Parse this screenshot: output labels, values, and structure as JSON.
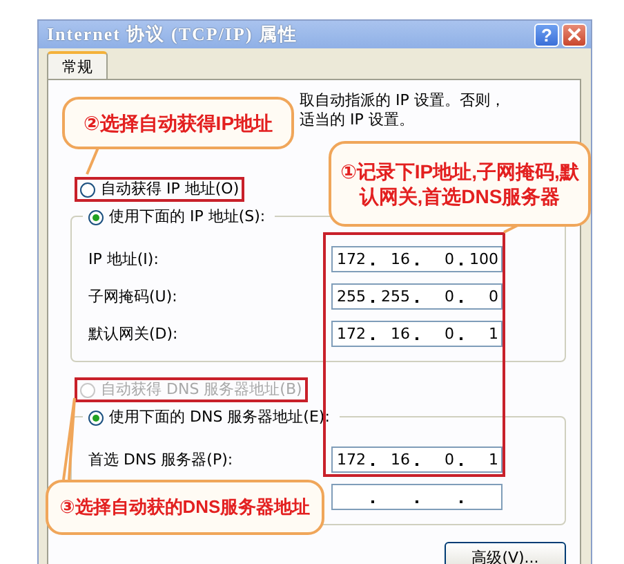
{
  "window": {
    "title": "Internet 协议 (TCP/IP) 属性",
    "help_label": "?"
  },
  "tabs": [
    {
      "label": "常规",
      "selected": true
    }
  ],
  "intro": [
    "取自动指派的 IP 设置。否则，",
    "适当的 IP 设置。"
  ],
  "ip_options": [
    {
      "label": "自动获得 IP 地址(O)",
      "selected": false,
      "disabled": false,
      "highlighted": true
    },
    {
      "label": "使用下面的 IP 地址(S):",
      "selected": true,
      "disabled": false,
      "highlighted": false
    }
  ],
  "ip_fields": [
    {
      "label": "IP 地址(I):",
      "octets": [
        "172",
        "16",
        "0",
        "100"
      ]
    },
    {
      "label": "子网掩码(U):",
      "octets": [
        "255",
        "255",
        "0",
        "0"
      ]
    },
    {
      "label": "默认网关(D):",
      "octets": [
        "172",
        "16",
        "0",
        "1"
      ]
    }
  ],
  "dns_options": [
    {
      "label": "自动获得 DNS 服务器地址(B)",
      "selected": false,
      "disabled": true,
      "highlighted": true
    },
    {
      "label": "使用下面的 DNS 服务器地址(E):",
      "selected": true,
      "disabled": false,
      "highlighted": false
    }
  ],
  "dns_fields": [
    {
      "kind": "filled",
      "label": "首选 DNS 服务器(P):",
      "octets": [
        "172",
        "16",
        "0",
        "1"
      ]
    },
    {
      "kind": "empty"
    }
  ],
  "buttons": [
    {
      "label": "高级(V)..."
    }
  ],
  "callouts": [
    {
      "text": "②选择自动获得IP地址"
    },
    {
      "text": "①记录下IP地址,子网掩码,默认网关,首选DNS服务器"
    },
    {
      "text": "③选择自动获的DNS服务器地址"
    }
  ]
}
